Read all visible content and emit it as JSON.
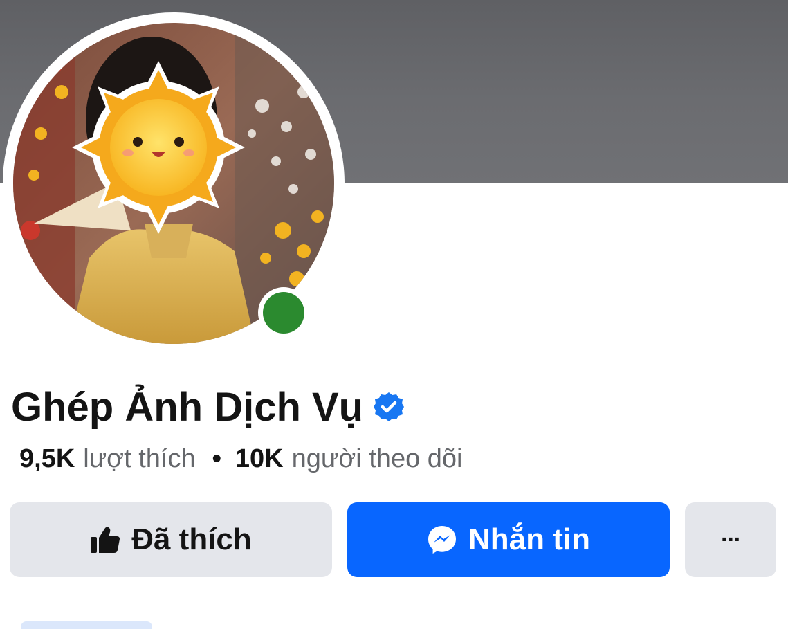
{
  "profile": {
    "name": "Ghép Ảnh Dịch Vụ",
    "verified_icon": "verified-badge-icon",
    "online_status_color": "#2b8a2f"
  },
  "stats": {
    "likes_value": "9,5K",
    "likes_label": "lượt thích",
    "separator": "•",
    "followers_value": "10K",
    "followers_label": "người theo dõi"
  },
  "actions": {
    "liked_label": "Đã thích",
    "message_label": "Nhắn tin",
    "more_label": "···"
  },
  "colors": {
    "primary": "#0866ff",
    "secondary_button": "#e4e6eb",
    "text_primary": "#141414",
    "text_secondary": "#65676b"
  }
}
